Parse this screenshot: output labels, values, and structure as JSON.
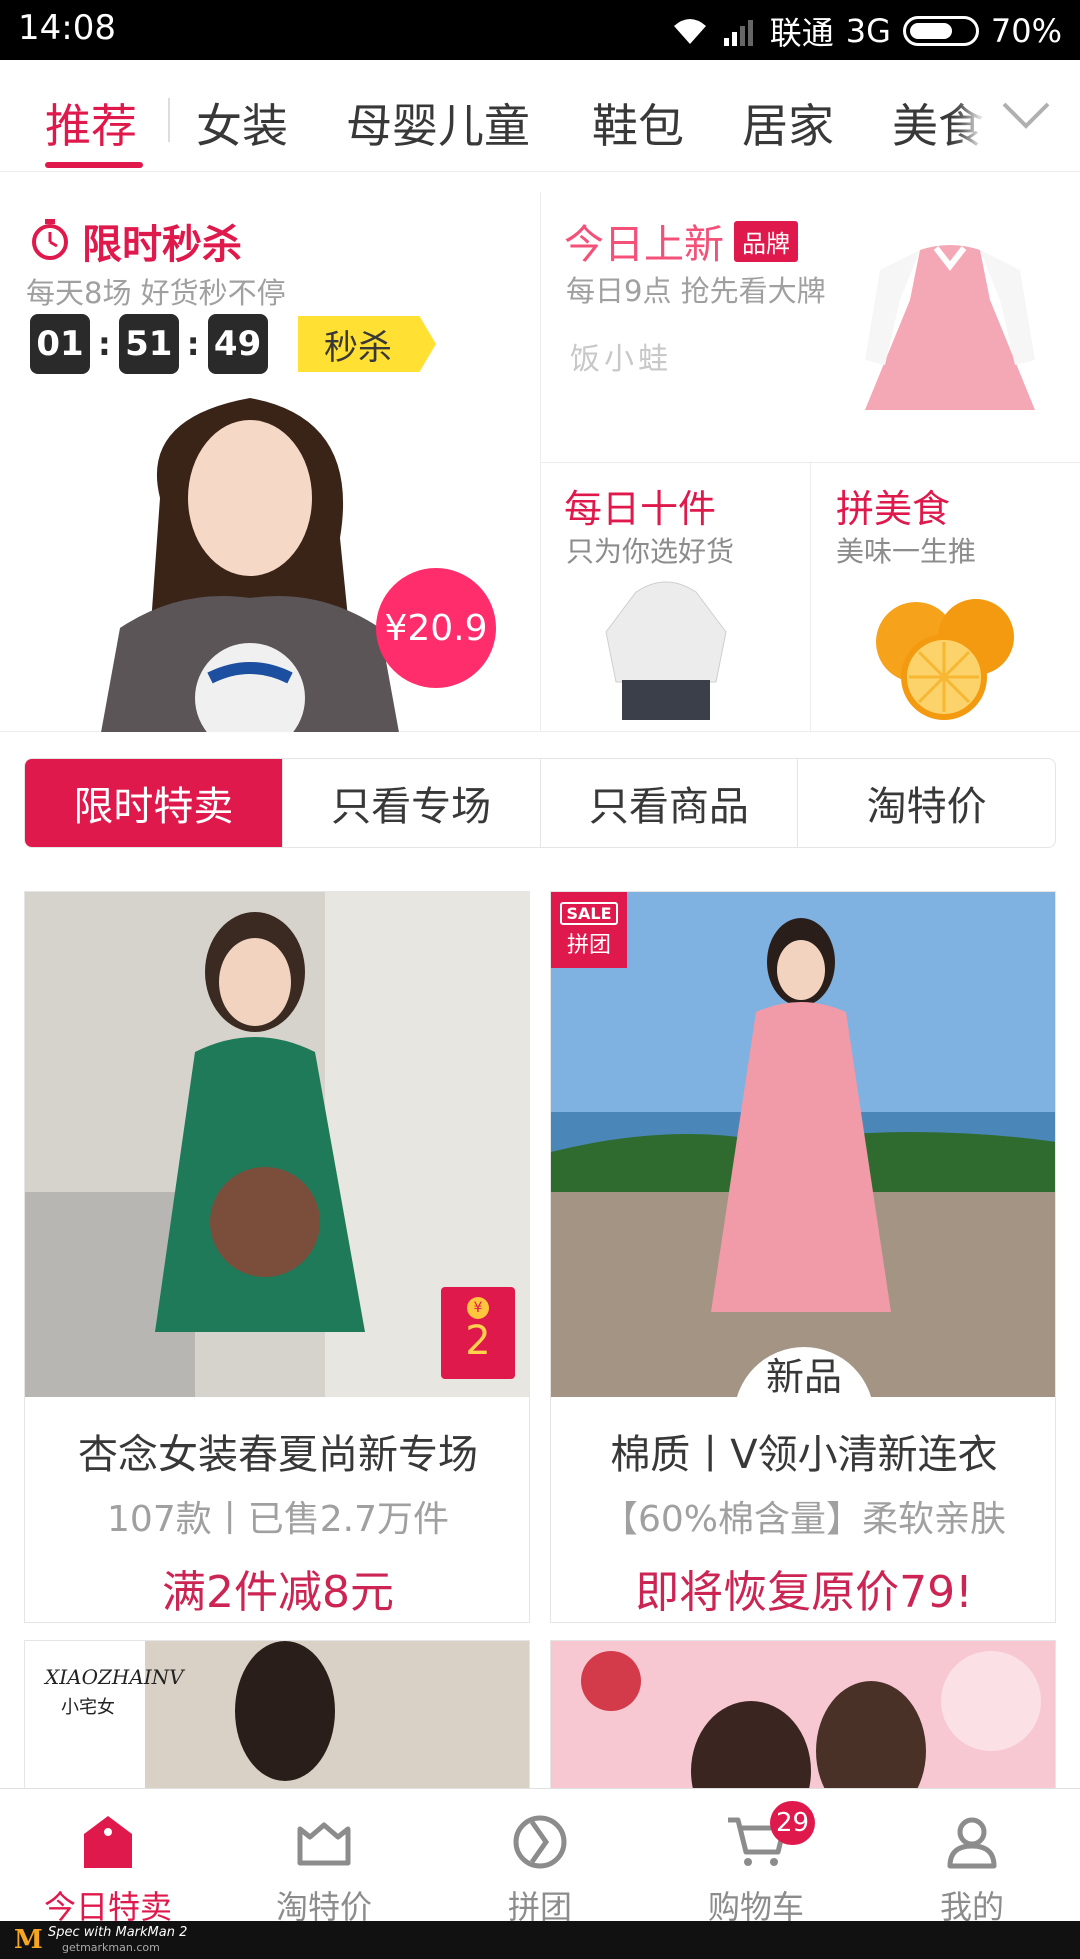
{
  "status_bar": {
    "time": "14:08",
    "carrier": "联通",
    "network": "3G",
    "battery": "70%",
    "battery_level": 0.7
  },
  "category_tabs": [
    "推荐",
    "女装",
    "母婴儿童",
    "鞋包",
    "居家",
    "美食"
  ],
  "active_category": "推荐",
  "flash_sale": {
    "title": "限时秒杀",
    "subtitle": "每天8场 好货秒不停",
    "countdown": [
      "01",
      "51",
      "49"
    ],
    "tag": "秒杀",
    "price": "¥20.9"
  },
  "new_today": {
    "title": "今日上新",
    "badge": "品牌",
    "subtitle": "每日9点 抢先看大牌",
    "brand": "饭小蛙"
  },
  "daily_ten": {
    "title": "每日十件",
    "subtitle": "只为你选好货"
  },
  "food": {
    "title": "拼美食",
    "subtitle": "美味一生推"
  },
  "filter_tabs": [
    "限时特卖",
    "只看专场",
    "只看商品",
    "淘特价"
  ],
  "active_filter": "限时特卖",
  "products": [
    {
      "name": "杏念女装春夏尚新专场",
      "desc": "107款丨已售2.7万件",
      "promo": "满2件减8元",
      "red_packet": "2"
    },
    {
      "name": "棉质丨V领小清新连衣",
      "desc": "【60%棉含量】柔软亲肤",
      "promo": "即将恢复原价79!",
      "sale_badge": "SALE",
      "sale_badge_sub": "拼团",
      "tag": "新品"
    }
  ],
  "lower_cards": [
    {
      "brand": "XIAOZHAINV",
      "brand_cn": "小宅女"
    }
  ],
  "bottom_nav": [
    {
      "label": "今日特卖",
      "icon": "bag-icon"
    },
    {
      "label": "淘特价",
      "icon": "tag-icon"
    },
    {
      "label": "拼团",
      "icon": "pintuan-icon"
    },
    {
      "label": "购物车",
      "icon": "cart-icon",
      "badge": "29"
    },
    {
      "label": "我的",
      "icon": "user-icon"
    }
  ],
  "footer": {
    "markman": "Spec with MarkMan 2",
    "url": "getmarkman.com"
  },
  "colors": {
    "accent": "#e0194c",
    "text": "#383838",
    "gray": "#a0a0a0",
    "promo": "#cc2554",
    "yellow": "#ffe033"
  }
}
